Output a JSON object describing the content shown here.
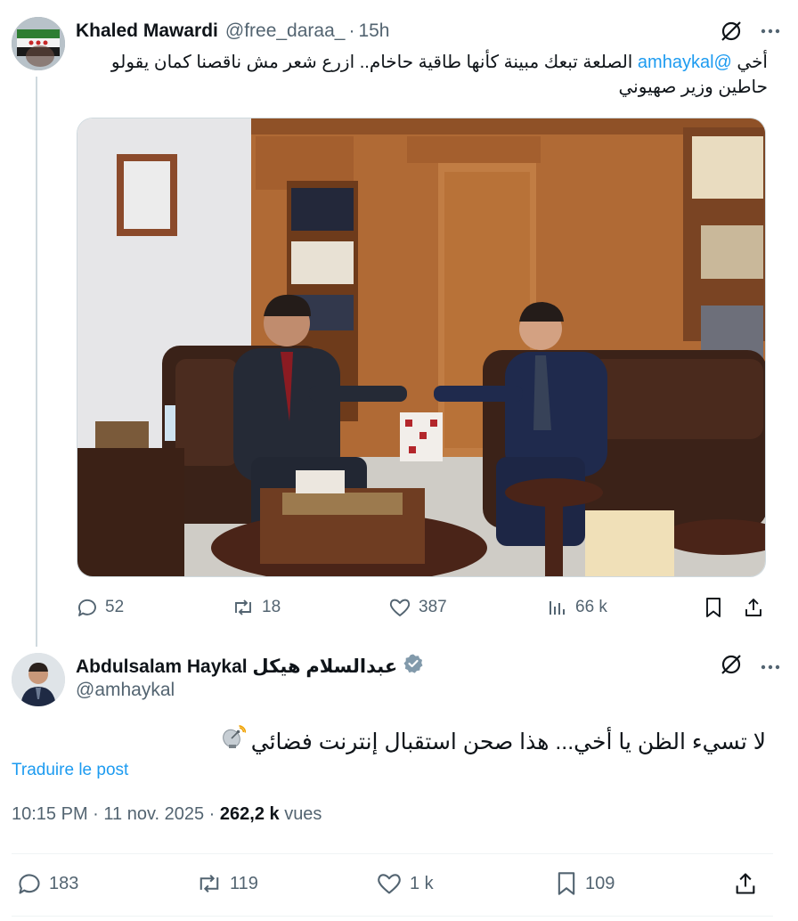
{
  "parent_tweet": {
    "author_name": "Khaled Mawardi",
    "handle": "@free_daraa_",
    "separator": "·",
    "time": "15h",
    "text_before_mention": "أخي ",
    "mention": "@amhaykal",
    "text_after_mention": " الصلعة تبعك مبينة كأنها طاقية حاخام.. ازرع شعر مش ناقصنا كمان يقولو حاطين وزير صهيوني",
    "stats": {
      "replies": "52",
      "reposts": "18",
      "likes": "387",
      "views": "66 k"
    }
  },
  "reply_tweet": {
    "author_name": "Abdulsalam Haykal عبدالسلام هيكل",
    "handle": "@amhaykal",
    "text": "لا تسيء الظن يا أخي... هذا صحن استقبال إنترنت فضائي",
    "translate_label": "Traduire le post",
    "time": "10:15 PM",
    "date": "11 nov. 2025",
    "separator": "·",
    "views_count": "262,2 k",
    "views_label": "vues",
    "stats": {
      "replies": "183",
      "reposts": "119",
      "likes": "1 k",
      "bookmarks": "109"
    }
  },
  "colors": {
    "link": "#1d9bf0",
    "secondary_text": "#536471",
    "verified_badge": "#829aab",
    "divider": "#eff3f4"
  },
  "icons": [
    "grok-icon",
    "more-icon",
    "reply-icon",
    "repost-icon",
    "like-icon",
    "views-icon",
    "bookmark-icon",
    "share-icon",
    "verified-badge-icon",
    "satellite-dish-emoji"
  ]
}
